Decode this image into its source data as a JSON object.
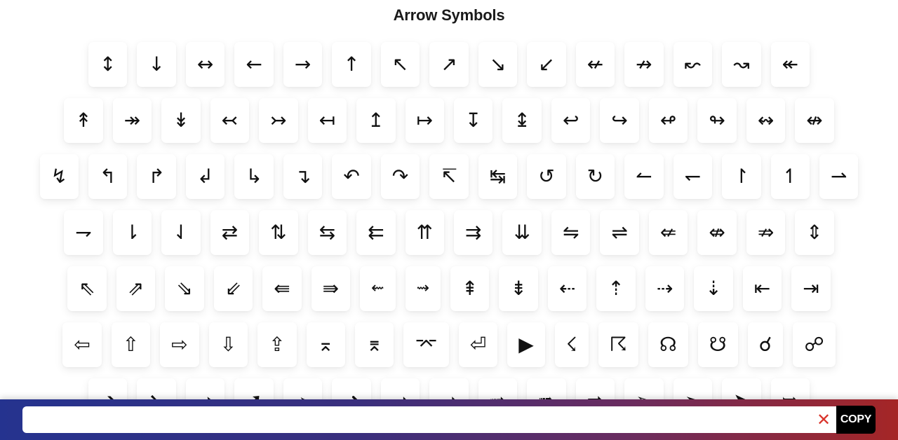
{
  "page": {
    "title": "Arrow Symbols"
  },
  "rows": [
    [
      "↕",
      "↓",
      "↔",
      "←",
      "→",
      "↑",
      "↖",
      "↗",
      "↘",
      "↙",
      "↚",
      "↛",
      "↜",
      "↝",
      "↞"
    ],
    [
      "↟",
      "↠",
      "↡",
      "↢",
      "↣",
      "↤",
      "↥",
      "↦",
      "↧",
      "↨",
      "↩",
      "↪",
      "↫",
      "↬",
      "↭",
      "↮"
    ],
    [
      "↯",
      "↰",
      "↱",
      "↲",
      "↳",
      "↴",
      "↶",
      "↷",
      "↸",
      "↹",
      "↺",
      "↻",
      "↼",
      "↽",
      "↾",
      "↿",
      "⇀"
    ],
    [
      "⇁",
      "⇂",
      "⇃",
      "⇄",
      "⇅",
      "⇆",
      "⇇",
      "⇈",
      "⇉",
      "⇊",
      "⇋",
      "⇌",
      "⇍",
      "⇎",
      "⇏",
      "⇕"
    ],
    [
      "⇖",
      "⇗",
      "⇘",
      "⇙",
      "⇚",
      "⇛",
      "⇜",
      "⇝",
      "⇞",
      "⇟",
      "⇠",
      "⇡",
      "⇢",
      "⇣",
      "⇤",
      "⇥"
    ],
    [
      "⇦",
      "⇧",
      "⇨",
      "⇩",
      "⇪",
      "⌅",
      "⌆",
      "⌤",
      "⏎",
      "▶",
      "☇",
      "☈",
      "☊",
      "☋",
      "☌",
      "☍"
    ],
    [
      "➔",
      "➘",
      "➙",
      "➚",
      "➛",
      "➜",
      "➝",
      "➞",
      "➟",
      "➠",
      "➡",
      "➢",
      "➣",
      "➤",
      "➥"
    ]
  ],
  "footer": {
    "input_value": "",
    "input_placeholder": "",
    "clear_label": "✕",
    "copy_label": "COPY"
  }
}
